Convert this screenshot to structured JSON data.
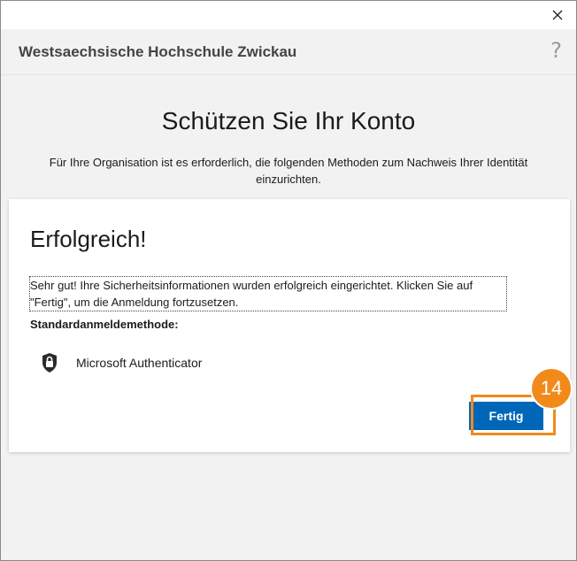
{
  "window": {
    "close_icon": "close-icon"
  },
  "header": {
    "org_name": "Westsaechsische Hochschule Zwickau",
    "help_label": "?"
  },
  "page": {
    "title": "Schützen Sie Ihr Konto",
    "subtitle": "Für Ihre Organisation ist es erforderlich, die folgenden Methoden zum Nachweis Ihrer Identität einzurichten."
  },
  "card": {
    "heading": "Erfolgreich!",
    "message": "Sehr gut! Ihre Sicherheitsinformationen wurden erfolgreich eingerichtet. Klicken Sie auf \"Fertig\", um die Anmeldung fortzusetzen.",
    "method_label": "Standardanmeldemethode:",
    "method_icon": "authenticator-lock-icon",
    "method_name": "Microsoft Authenticator",
    "done_label": "Fertig"
  },
  "annotation": {
    "step_number": "14",
    "highlight_color": "#f28a1b"
  },
  "colors": {
    "accent": "#0067b8",
    "background": "#f2f2f2"
  }
}
